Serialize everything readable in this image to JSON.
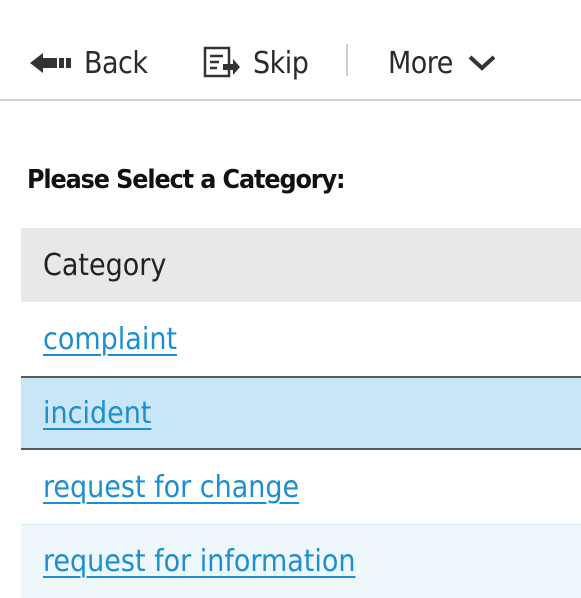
{
  "toolbar": {
    "back_label": "Back",
    "skip_label": "Skip",
    "more_label": "More"
  },
  "heading": "Please Select a Category:",
  "grid": {
    "column_header": "Category",
    "rows": [
      {
        "label": "complaint"
      },
      {
        "label": "incident"
      },
      {
        "label": "request for change"
      },
      {
        "label": "request for information"
      }
    ]
  },
  "colors": {
    "link": "#1d8fd1",
    "selected_row": "#c8e6f5",
    "header_bg": "#e8e8e8"
  },
  "icons": {
    "back": "arrow-left-icon",
    "skip": "skip-icon",
    "more": "chevron-down-icon"
  }
}
